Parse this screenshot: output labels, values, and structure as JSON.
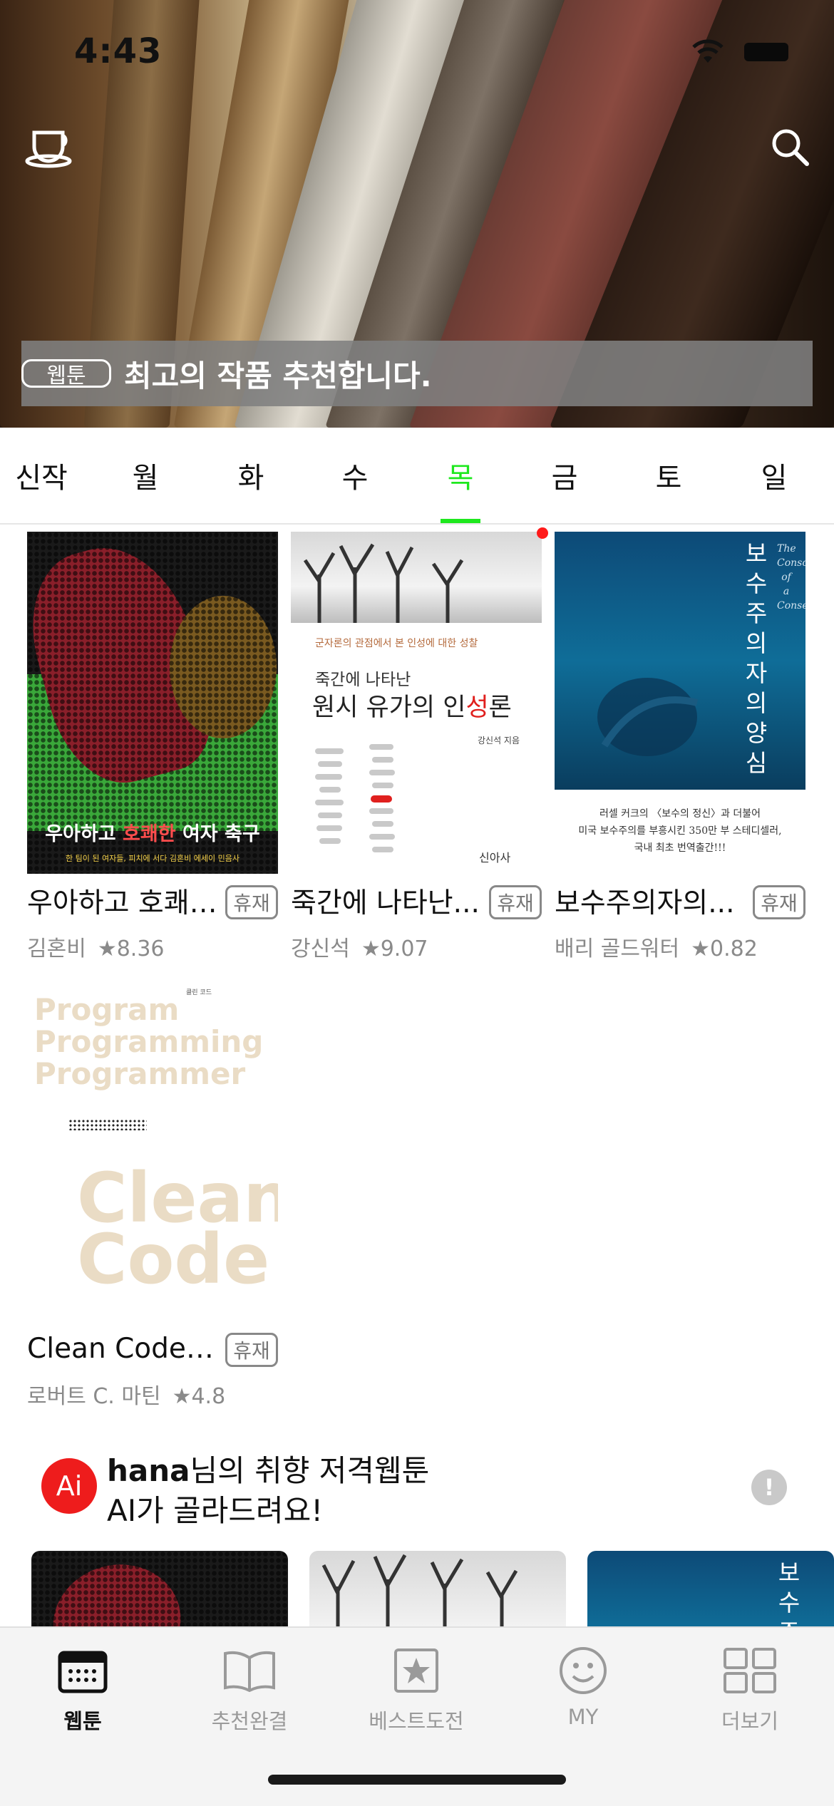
{
  "status_bar": {
    "time": "4:43"
  },
  "hero": {
    "tag": "웹툰",
    "title": "최고의 작품 추천합니다.",
    "left_icon": "coffee-cup-icon",
    "right_icon": "search-icon"
  },
  "day_tabs": {
    "items": [
      "신작",
      "월",
      "화",
      "수",
      "목",
      "금",
      "토",
      "일"
    ],
    "active": "목",
    "active_color": "#1ee81e"
  },
  "cards": [
    {
      "title": "우아하고 호쾌…",
      "badge": "휴재",
      "author": "김혼비",
      "rating": "★8.36",
      "cover": {
        "title_a": "우아하고 ",
        "title_hl": "호쾌한",
        "title_b": " 여자 축구",
        "subtitle": "한 팀이 된 여자들, 피치에 서다       김혼비 에세이      민음사"
      }
    },
    {
      "title": "죽간에 나타난...",
      "badge": "휴재",
      "author": "강신석",
      "rating": "★9.07",
      "new": true,
      "cover": {
        "sub": "군자론의 관점에서 본 인성에 대한 성찰",
        "line1": "죽간에 나타난",
        "line2a": "원시 유가의 인",
        "line2_red": "성",
        "line2b": "론",
        "author": "강신석 지음",
        "publisher": "신아사"
      }
    },
    {
      "title": "보수주의자의...",
      "badge": "휴재",
      "author": "배리 골드워터",
      "rating": "★0.82",
      "cover": {
        "vertical": "보수주의자의 양심",
        "vertical_en": "The Conscience of a Conservative",
        "caption": [
          "러셀 커크의 〈보수의 정신〉과 더불어",
          "미국 보수주의를 부흥시킨 350만 부 스테디셀러,",
          "국내 최초 번역출간!!!"
        ]
      }
    },
    {
      "title": "Clean Code(…",
      "badge": "휴재",
      "author": "로버트 C. 마틴",
      "rating": "★4.8",
      "cover": {
        "words": [
          "Program",
          "Programming",
          "Programmer"
        ],
        "big": [
          "Clean",
          "Code"
        ],
        "small": "클린 코드"
      }
    }
  ],
  "ai_section": {
    "badge": "Ai",
    "user": "hana",
    "line1_suffix": "님의 취향 저격웹툰",
    "line2": "AI가 골라드려요!",
    "info": "!"
  },
  "bottom_nav": [
    {
      "label": "웹툰",
      "icon": "calendar-icon",
      "active": true
    },
    {
      "label": "추천완결",
      "icon": "open-book-icon",
      "active": false
    },
    {
      "label": "베스트도전",
      "icon": "star-box-icon",
      "active": false
    },
    {
      "label": "MY",
      "icon": "smiley-icon",
      "active": false
    },
    {
      "label": "더보기",
      "icon": "grid-icon",
      "active": false
    }
  ]
}
